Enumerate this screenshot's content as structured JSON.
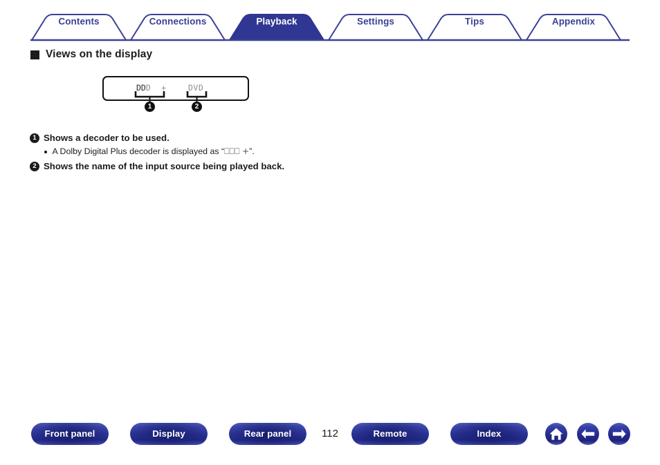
{
  "tabs": [
    {
      "label": "Contents",
      "active": false
    },
    {
      "label": "Connections",
      "active": false
    },
    {
      "label": "Playback",
      "active": true
    },
    {
      "label": "Settings",
      "active": false
    },
    {
      "label": "Tips",
      "active": false
    },
    {
      "label": "Appendix",
      "active": false
    }
  ],
  "section": {
    "heading": "Views on the display",
    "bullet_marker": "square-marker"
  },
  "display_figure": {
    "decoder_logo": "DD",
    "decoder_suffix": "D",
    "decoder_plus": "+",
    "decoder_text": "D",
    "source_text": "DVD",
    "callouts": [
      {
        "number": "1",
        "target": "decoder-indicator"
      },
      {
        "number": "2",
        "target": "source-indicator"
      }
    ]
  },
  "notes": [
    {
      "number": "1",
      "text": "Shows a decoder to be used."
    },
    {
      "number": "2",
      "text": "Shows the name of the input source being played back."
    }
  ],
  "bullet": {
    "prefix": "A Dolby Digital Plus decoder is displayed as “",
    "glyphs": "⎕⎕⎕",
    "plus": "+",
    "suffix": "”."
  },
  "footer": {
    "buttons": [
      {
        "label": "Front panel"
      },
      {
        "label": "Display"
      },
      {
        "label": "Rear panel"
      },
      {
        "label": "Remote"
      },
      {
        "label": "Index"
      }
    ],
    "page_number": "112",
    "icons": [
      {
        "name": "home-icon"
      },
      {
        "name": "arrow-left-icon"
      },
      {
        "name": "arrow-right-icon"
      }
    ]
  },
  "colors": {
    "brand_navy": "#3b4296",
    "tab_active_fill": "#2f3792",
    "pill_gradient_top": "#5660bd",
    "pill_gradient_mid": "#2b3397",
    "text_dark": "#1c1c1c",
    "display_dim": "#8e8e8e"
  }
}
